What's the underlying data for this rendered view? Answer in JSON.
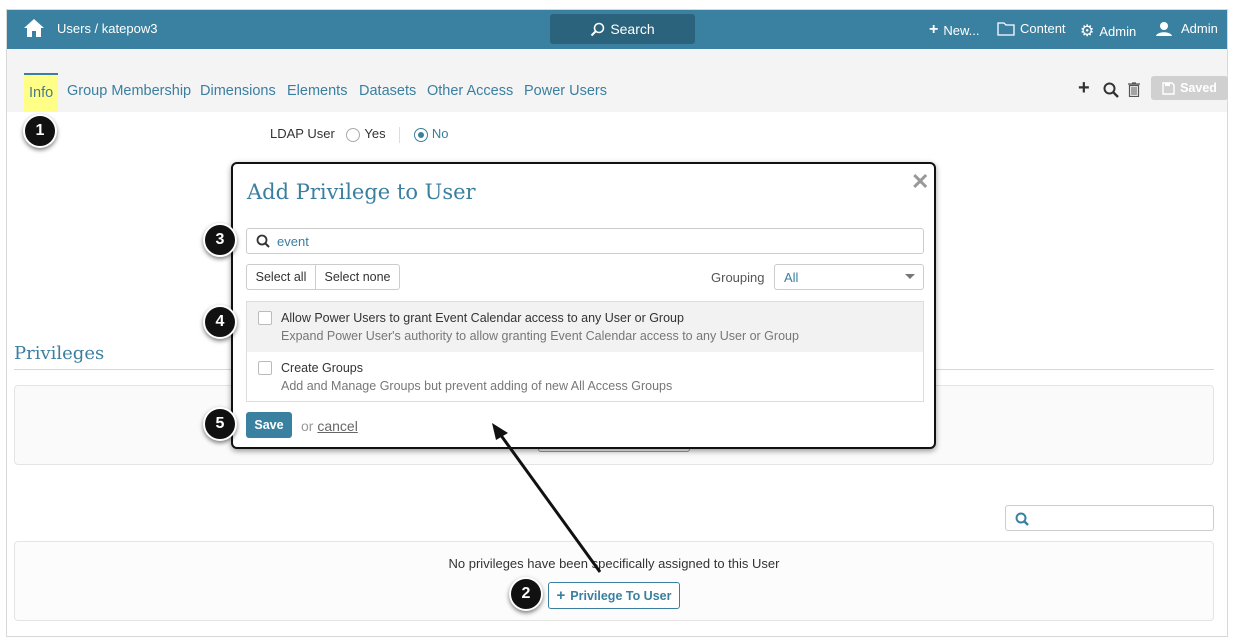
{
  "topbar": {
    "breadcrumb": "Users / katepow3",
    "search": "Search",
    "new": "New...",
    "content": "Content",
    "admin_settings": "Admin",
    "user": "Admin"
  },
  "tabs": [
    "Info",
    "Group Membership",
    "Dimensions",
    "Elements",
    "Datasets",
    "Other Access",
    "Power Users"
  ],
  "toolbar": {
    "saved": "Saved"
  },
  "ldap": {
    "label": "LDAP User",
    "yes": "Yes",
    "no": "No",
    "selected": "No"
  },
  "privileges": {
    "title": "Privileges",
    "empty": "No privileges have been specifically assigned to this User",
    "add_button": "Privilege To User"
  },
  "dialog": {
    "title": "Add Privilege to User",
    "search_value": "event",
    "select_all": "Select all",
    "select_none": "Select none",
    "grouping_label": "Grouping",
    "grouping_value": "All",
    "items": [
      {
        "title": "Allow Power Users to grant Event Calendar access to any User or Group",
        "desc": "Expand Power User's authority to allow granting Event Calendar access to any User or Group"
      },
      {
        "title": "Create Groups",
        "desc": "Add and Manage Groups but prevent adding of new All Access Groups"
      }
    ],
    "save": "Save",
    "or": "or",
    "cancel": "cancel"
  },
  "badges": [
    "1",
    "2",
    "3",
    "4",
    "5"
  ],
  "colors": {
    "primary": "#3a80a0",
    "highlight": "#ffff88"
  }
}
